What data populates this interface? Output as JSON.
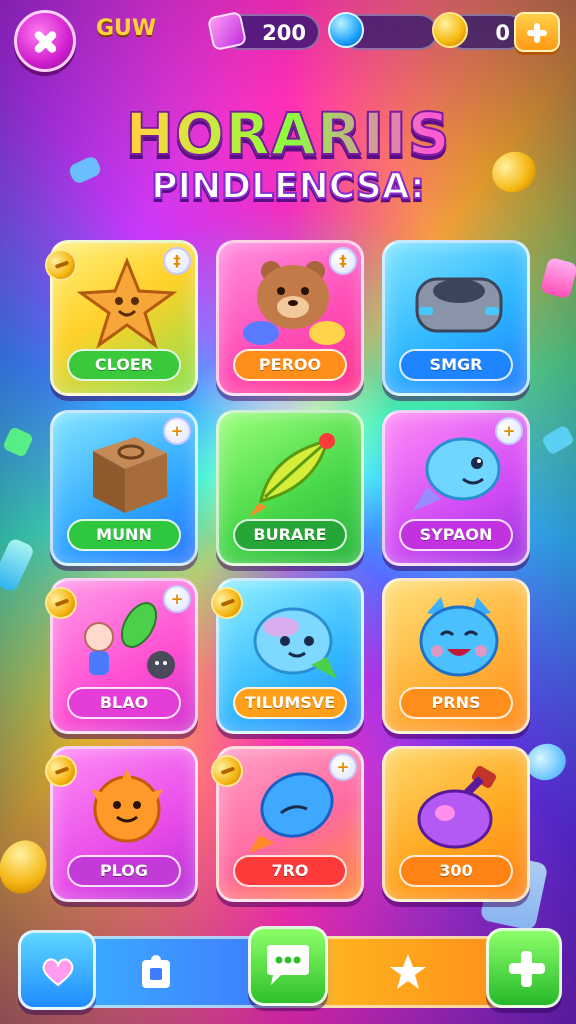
{
  "header": {
    "player_name": "GUW",
    "gems_value": "200",
    "coins_value": "0",
    "icons": [
      "close-icon",
      "gem-icon",
      "crystal-icon",
      "coin-icon",
      "plus-icon"
    ]
  },
  "title": {
    "main": "HORARIIS",
    "sub": "PINDLENCSA:"
  },
  "cards": [
    {
      "label": "CLOER",
      "color": "#ffd83a",
      "pill": "#39c93a",
      "icon": "cookie-star-icon",
      "badge": "‡"
    },
    {
      "label": "PEROO",
      "color": "#ff4fb8",
      "pill": "#ff8f1a",
      "icon": "bear-icon",
      "badge": "‡"
    },
    {
      "label": "SMGR",
      "color": "#2db6ff",
      "pill": "#1f84ff",
      "icon": "gadget-icon",
      "badge": ""
    },
    {
      "label": "MUNN",
      "color": "#2fa6ff",
      "pill": "#2fc740",
      "icon": "crate-icon",
      "badge": "+"
    },
    {
      "label": "BURARE",
      "color": "#4ad94a",
      "pill": "#26a637",
      "icon": "leaf-rocket-icon",
      "badge": ""
    },
    {
      "label": "SYPAON",
      "color": "#d14cf5",
      "pill": "#c232e0",
      "icon": "fish-creature-icon",
      "badge": "+"
    },
    {
      "label": "BLAO",
      "color": "#ff4ed2",
      "pill": "#e43cd6",
      "icon": "friends-icon",
      "badge": "+"
    },
    {
      "label": "TILUMSVE",
      "color": "#33b8ff",
      "pill": "#ff9f1a",
      "icon": "dolphin-icon",
      "badge": ""
    },
    {
      "label": "PRNS",
      "color": "#ffb23a",
      "pill": "#ff8e1a",
      "icon": "cat-icon",
      "badge": ""
    },
    {
      "label": "PLOG",
      "color": "#e84be8",
      "pill": "#c43ad8",
      "icon": "sun-critter-icon",
      "badge": ""
    },
    {
      "label": "7RO",
      "color": "#ff6a9f",
      "pill": "#ff3a3a",
      "icon": "fish-icon",
      "badge": "+"
    },
    {
      "label": "300",
      "color": "#ffa820",
      "pill": "#ff8314",
      "icon": "potion-icon",
      "badge": ""
    }
  ],
  "bottom_nav": {
    "items": [
      "heart-icon",
      "puzzle-icon",
      "chat-icon",
      "star-icon",
      "plus-icon"
    ]
  }
}
